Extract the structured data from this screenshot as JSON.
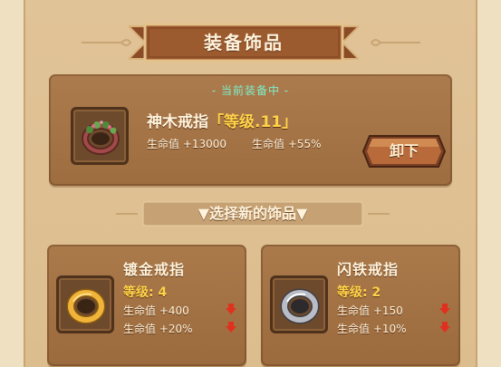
{
  "title": "装备饰品",
  "current": {
    "label": "- 当前装备中 -",
    "name": "神木戒指",
    "level_text": "「等级.11」",
    "stat1": "生命值 +13000",
    "stat2": "生命值 +55%",
    "unequip_label": "卸下",
    "icon": "wooden-vine-ring-icon"
  },
  "choose_label": "▼选择新的饰品▼",
  "options": [
    {
      "name": "镀金戒指",
      "level": "等级: 4",
      "stat1": "生命值 +400",
      "stat2": "生命值 +20%",
      "icon": "gold-ring-icon"
    },
    {
      "name": "闪铁戒指",
      "level": "等级: 2",
      "stat1": "生命值 +150",
      "stat2": "生命值 +10%",
      "icon": "iron-ring-icon"
    }
  ],
  "colors": {
    "accent_green": "#7df0c9",
    "level_gold": "#ffd34a",
    "decrease_red": "#e0301e",
    "panel_brown": "#a57447"
  }
}
